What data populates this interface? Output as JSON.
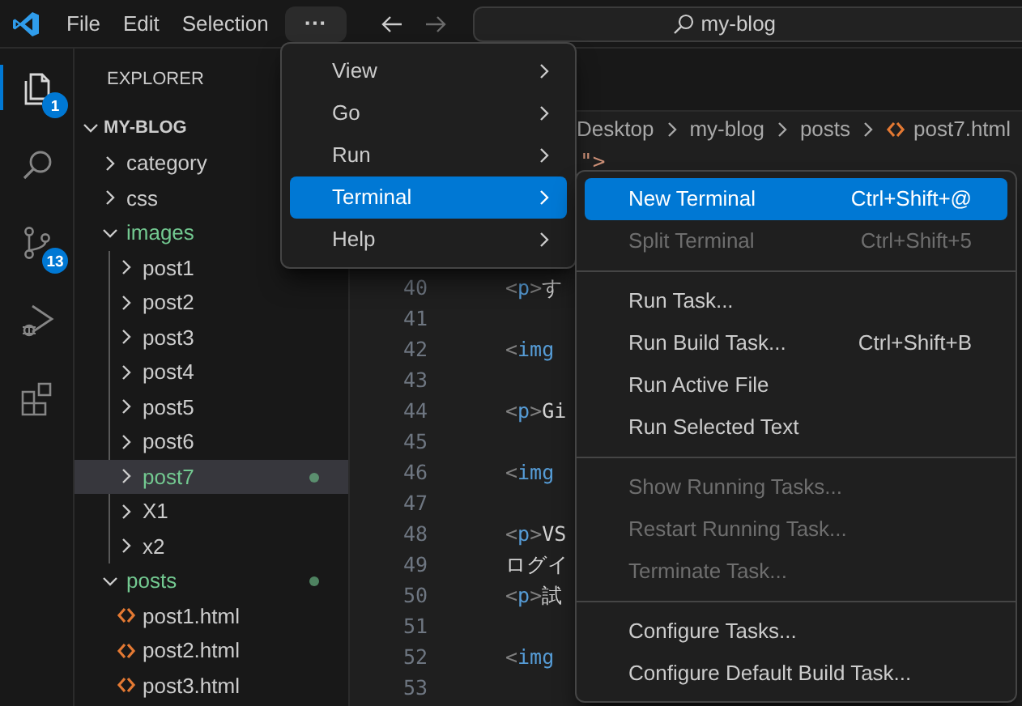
{
  "title_bar": {
    "menus": [
      "File",
      "Edit",
      "Selection"
    ],
    "more_button": "···",
    "back_enabled": true,
    "forward_enabled": false,
    "command_center": "my-blog"
  },
  "activity_bar": [
    {
      "kind": "explorer",
      "selected": true,
      "badge": "1"
    },
    {
      "kind": "search",
      "selected": false
    },
    {
      "kind": "source-control",
      "selected": false,
      "badge": "13"
    },
    {
      "kind": "run-debug",
      "selected": false
    },
    {
      "kind": "extensions",
      "selected": false
    }
  ],
  "sidebar": {
    "title": "EXPLORER",
    "root": {
      "label": "MY-BLOG",
      "expanded": true,
      "children": [
        {
          "kind": "folder",
          "label": "category",
          "expanded": false,
          "modified": false,
          "selected": false
        },
        {
          "kind": "folder",
          "label": "css",
          "expanded": false,
          "modified": false,
          "selected": false
        },
        {
          "kind": "folder",
          "label": "images",
          "expanded": true,
          "modified": true,
          "selected": false,
          "children": [
            {
              "kind": "folder",
              "label": "post1",
              "expanded": false,
              "modified": false,
              "selected": false
            },
            {
              "kind": "folder",
              "label": "post2",
              "expanded": false,
              "modified": false,
              "selected": false
            },
            {
              "kind": "folder",
              "label": "post3",
              "expanded": false,
              "modified": false,
              "selected": false
            },
            {
              "kind": "folder",
              "label": "post4",
              "expanded": false,
              "modified": false,
              "selected": false
            },
            {
              "kind": "folder",
              "label": "post5",
              "expanded": false,
              "modified": false,
              "selected": false
            },
            {
              "kind": "folder",
              "label": "post6",
              "expanded": false,
              "modified": false,
              "selected": false
            },
            {
              "kind": "folder",
              "label": "post7",
              "expanded": false,
              "modified": true,
              "dot": true,
              "selected": true
            },
            {
              "kind": "folder",
              "label": "X1",
              "expanded": false,
              "modified": false,
              "selected": false
            },
            {
              "kind": "folder",
              "label": "x2",
              "expanded": false,
              "modified": false,
              "selected": false
            }
          ]
        },
        {
          "kind": "folder",
          "label": "posts",
          "expanded": true,
          "modified": true,
          "dot": true,
          "selected": false,
          "children": [
            {
              "kind": "html",
              "label": "post1.html",
              "modified": false,
              "selected": false
            },
            {
              "kind": "html",
              "label": "post2.html",
              "modified": false,
              "selected": false
            },
            {
              "kind": "html",
              "label": "post3.html",
              "modified": false,
              "selected": false
            }
          ]
        }
      ]
    }
  },
  "editor": {
    "breadcrumbs": [
      {
        "kind": "folder",
        "label": "Desktop"
      },
      {
        "kind": "folder",
        "label": "my-blog"
      },
      {
        "kind": "folder",
        "label": "posts"
      },
      {
        "kind": "html",
        "label": "post7.html"
      }
    ],
    "fragment": "\">",
    "lines": [
      {
        "number": "40",
        "tokens": [
          {
            "kind": "bracket",
            "text": "<"
          },
          {
            "kind": "tag",
            "text": "p"
          },
          {
            "kind": "bracket",
            "text": ">"
          },
          {
            "kind": "text",
            "text": "す"
          }
        ]
      },
      {
        "number": "41"
      },
      {
        "number": "42",
        "tokens": [
          {
            "kind": "bracket",
            "text": "<"
          },
          {
            "kind": "tag",
            "text": "img"
          }
        ]
      },
      {
        "number": "43"
      },
      {
        "number": "44",
        "tokens": [
          {
            "kind": "bracket",
            "text": "<"
          },
          {
            "kind": "tag",
            "text": "p"
          },
          {
            "kind": "bracket",
            "text": ">"
          },
          {
            "kind": "text",
            "text": "Gi"
          }
        ]
      },
      {
        "number": "45"
      },
      {
        "number": "46",
        "tokens": [
          {
            "kind": "bracket",
            "text": "<"
          },
          {
            "kind": "tag",
            "text": "img"
          }
        ]
      },
      {
        "number": "47"
      },
      {
        "number": "48",
        "tokens": [
          {
            "kind": "bracket",
            "text": "<"
          },
          {
            "kind": "tag",
            "text": "p"
          },
          {
            "kind": "bracket",
            "text": ">"
          },
          {
            "kind": "text",
            "text": "VS"
          }
        ]
      },
      {
        "number": "49",
        "tokens": [
          {
            "kind": "text",
            "text": "ログイ"
          }
        ]
      },
      {
        "number": "50",
        "tokens": [
          {
            "kind": "bracket",
            "text": "<"
          },
          {
            "kind": "tag",
            "text": "p"
          },
          {
            "kind": "bracket",
            "text": ">"
          },
          {
            "kind": "text",
            "text": "試"
          }
        ]
      },
      {
        "number": "51"
      },
      {
        "number": "52",
        "tokens": [
          {
            "kind": "bracket",
            "text": "<"
          },
          {
            "kind": "tag",
            "text": "img"
          }
        ]
      },
      {
        "number": "53"
      }
    ]
  },
  "menu": [
    {
      "label": "View",
      "selected": false
    },
    {
      "label": "Go",
      "selected": false
    },
    {
      "label": "Run",
      "selected": false
    },
    {
      "label": "Terminal",
      "selected": true
    },
    {
      "label": "Help",
      "selected": false
    }
  ],
  "submenu": [
    {
      "kind": "item",
      "label": "New Terminal",
      "shortcut": "Ctrl+Shift+@",
      "selected": true,
      "disabled": false
    },
    {
      "kind": "item",
      "label": "Split Terminal",
      "shortcut": "Ctrl+Shift+5",
      "selected": false,
      "disabled": true
    },
    {
      "kind": "separator"
    },
    {
      "kind": "item",
      "label": "Run Task...",
      "selected": false,
      "disabled": false
    },
    {
      "kind": "item",
      "label": "Run Build Task...",
      "shortcut": "Ctrl+Shift+B",
      "selected": false,
      "disabled": false
    },
    {
      "kind": "item",
      "label": "Run Active File",
      "selected": false,
      "disabled": false
    },
    {
      "kind": "item",
      "label": "Run Selected Text",
      "selected": false,
      "disabled": false
    },
    {
      "kind": "separator"
    },
    {
      "kind": "item",
      "label": "Show Running Tasks...",
      "selected": false,
      "disabled": true
    },
    {
      "kind": "item",
      "label": "Restart Running Task...",
      "selected": false,
      "disabled": true
    },
    {
      "kind": "item",
      "label": "Terminate Task...",
      "selected": false,
      "disabled": true
    },
    {
      "kind": "separator"
    },
    {
      "kind": "item",
      "label": "Configure Tasks...",
      "selected": false,
      "disabled": false
    },
    {
      "kind": "item",
      "label": "Configure Default Build Task...",
      "selected": false,
      "disabled": false
    }
  ]
}
